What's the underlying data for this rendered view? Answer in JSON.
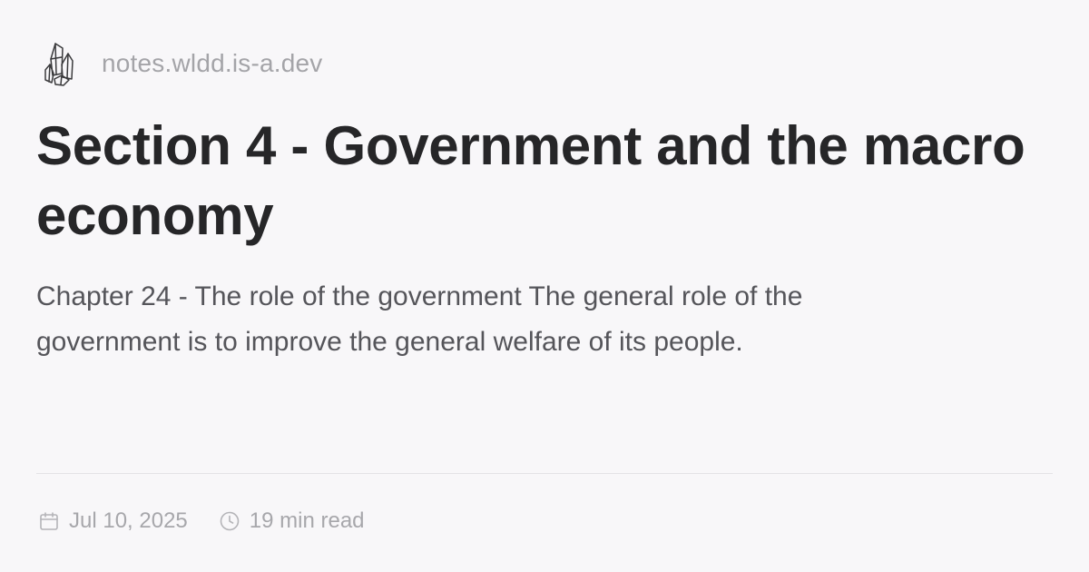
{
  "site": {
    "name": "notes.wldd.is-a.dev",
    "logo_icon": "crystal-cluster-icon"
  },
  "post": {
    "title": "Section 4 - Government and the macro economy",
    "excerpt": "Chapter 24 - The role of the government The general role of the government is to improve the general welfare of its people."
  },
  "meta": {
    "date": "Jul 10, 2025",
    "date_icon": "calendar-icon",
    "read_time": "19 min read",
    "read_time_icon": "clock-icon"
  },
  "colors": {
    "background": "#f8f7f9",
    "title": "#262628",
    "excerpt": "#55555a",
    "muted": "#a7a7ab",
    "divider": "#e4e3e6"
  }
}
